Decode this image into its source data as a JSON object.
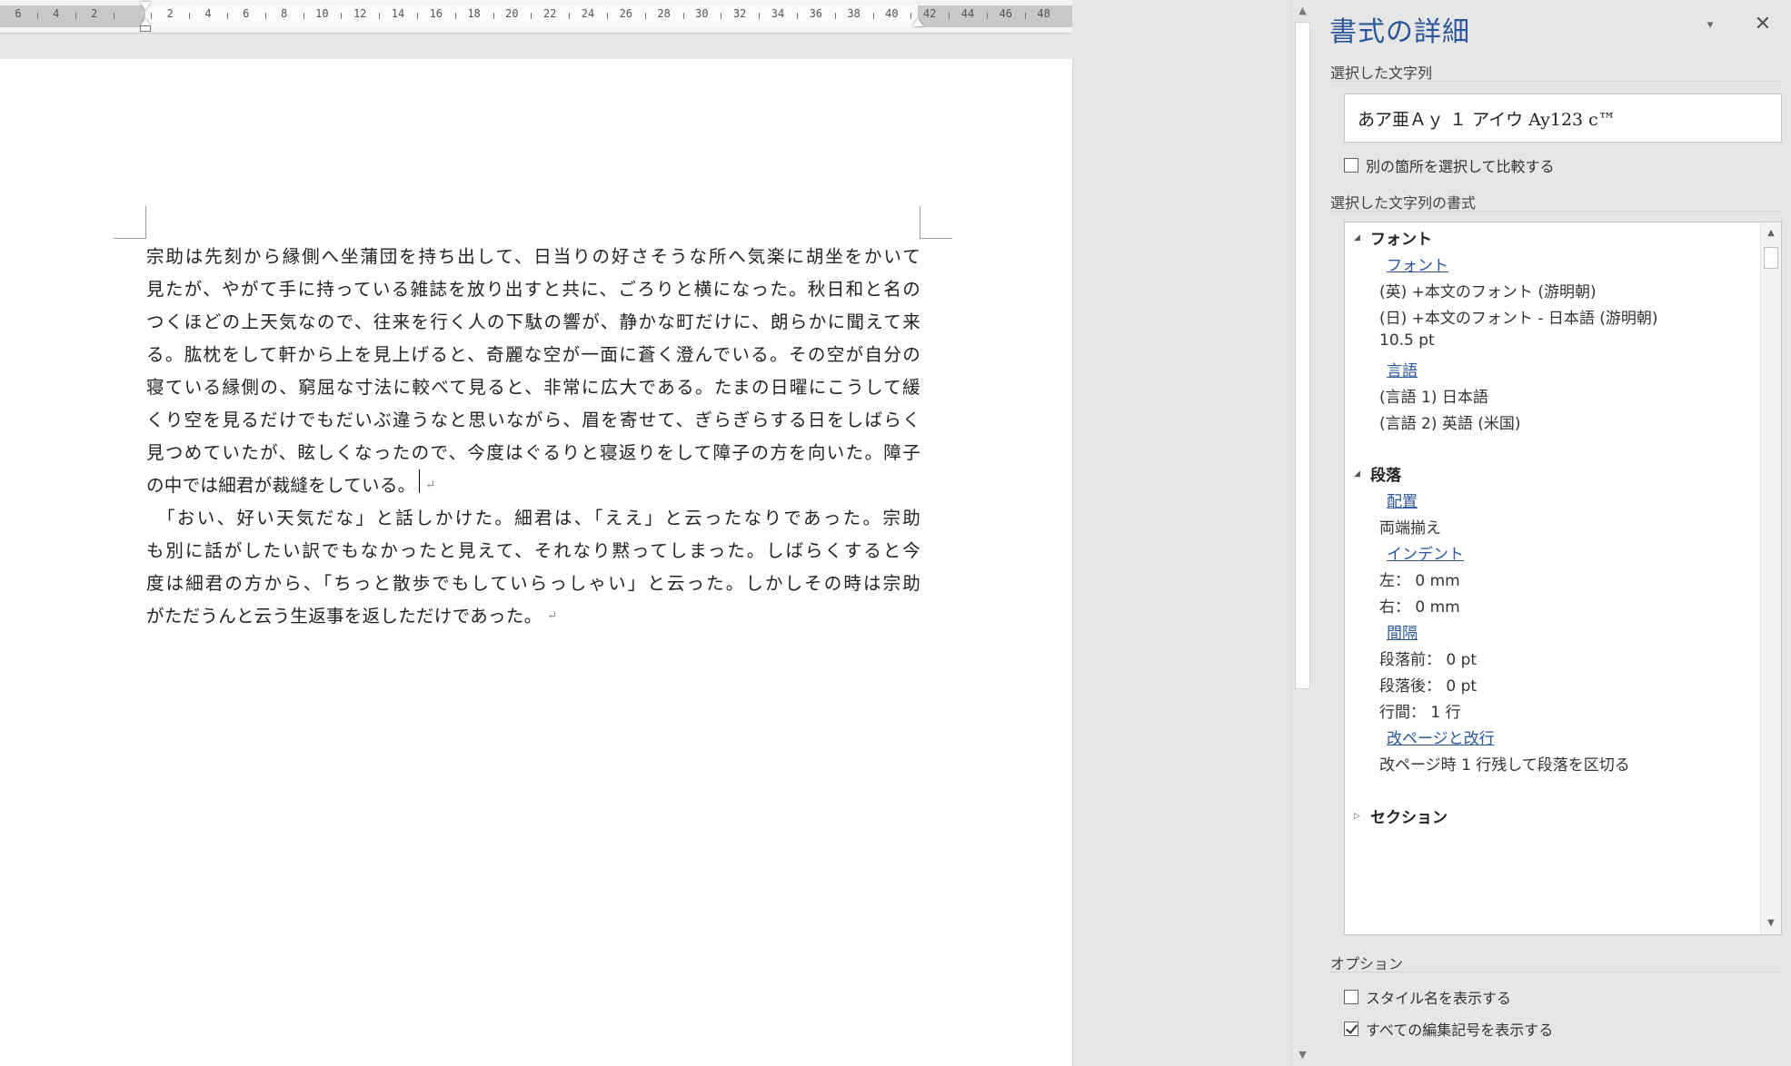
{
  "ruler": {
    "labels": [
      "6",
      "4",
      "2",
      "",
      "2",
      "4",
      "6",
      "8",
      "10",
      "12",
      "14",
      "16",
      "18",
      "20",
      "22",
      "24",
      "26",
      "28",
      "30",
      "32",
      "34",
      "36",
      "38",
      "40",
      "42",
      "44",
      "46",
      "48"
    ]
  },
  "document": {
    "lines": [
      "宗助は先刻から縁側へ坐蒲団を持ち出して、日当りの好さそうな所へ気楽に胡坐をかいて",
      "見たが、やがて手に持っている雑誌を放り出すと共に、ごろりと横になった。秋日和と名の",
      "つくほどの上天気なので、往来を行く人の下駄の響が、静かな町だけに、朗らかに聞えて来",
      "る。肱枕をして軒から上を見上げると、奇麗な空が一面に蒼く澄んでいる。その空が自分の",
      "寝ている縁側の、窮屈な寸法に較べて見ると、非常に広大である。たまの日曜にこうして緩",
      "くり空を見るだけでもだいぶ違うなと思いながら、眉を寄せて、ぎらぎらする日をしばらく",
      "見つめていたが、眩しくなったので、今度はぐるりと寝返りをして障子の方を向いた。障子",
      "の中では細君が裁縫をしている。",
      "　「おい、好い天気だな」と話しかけた。細君は、「ええ」と云ったなりであった。宗助",
      "も別に話がしたい訳でもなかったと見えて、それなり黙ってしまった。しばらくすると今",
      "度は細君の方から、「ちっと散歩でもしていらっしゃい」と云った。しかしその時は宗助",
      "がただうんと云う生返事を返しただけであった。"
    ],
    "para_mark": "↵"
  },
  "pane": {
    "title": "書式の詳細",
    "dropdown_icon": "▾",
    "close_icon": "✕",
    "selected_text_label": "選択した文字列",
    "sample_text": "あア亜Ａｙ １ アイウ Ay123 c™",
    "compare_label": "別の箇所を選択して比較する",
    "selected_format_label": "選択した文字列の書式",
    "font_group": "フォント",
    "font_link": "フォント",
    "font_en": "(英) +本文のフォント (游明朝)",
    "font_jp": "(日) +本文のフォント - 日本語 (游明朝)",
    "font_size": "10.5 pt",
    "lang_link": "言語",
    "lang1": "(言語 1) 日本語",
    "lang2": "(言語 2) 英語 (米国)",
    "para_group": "段落",
    "align_link": "配置",
    "align_val": "両端揃え",
    "indent_link": "インデント",
    "indent_left": "左：   0 mm",
    "indent_right": "右：   0 mm",
    "spacing_link": "間隔",
    "space_before": "段落前：   0 pt",
    "space_after": "段落後：   0 pt",
    "line_spacing": "行間：   1 行",
    "page_break_link": "改ページと改行",
    "widow": "改ページ時 1 行残して段落を区切る",
    "section_group": "セクション",
    "options_label": "オプション",
    "show_style_label": "スタイル名を表示する",
    "show_marks_label": "すべての編集記号を表示する",
    "show_style_checked": false,
    "show_marks_checked": true
  }
}
